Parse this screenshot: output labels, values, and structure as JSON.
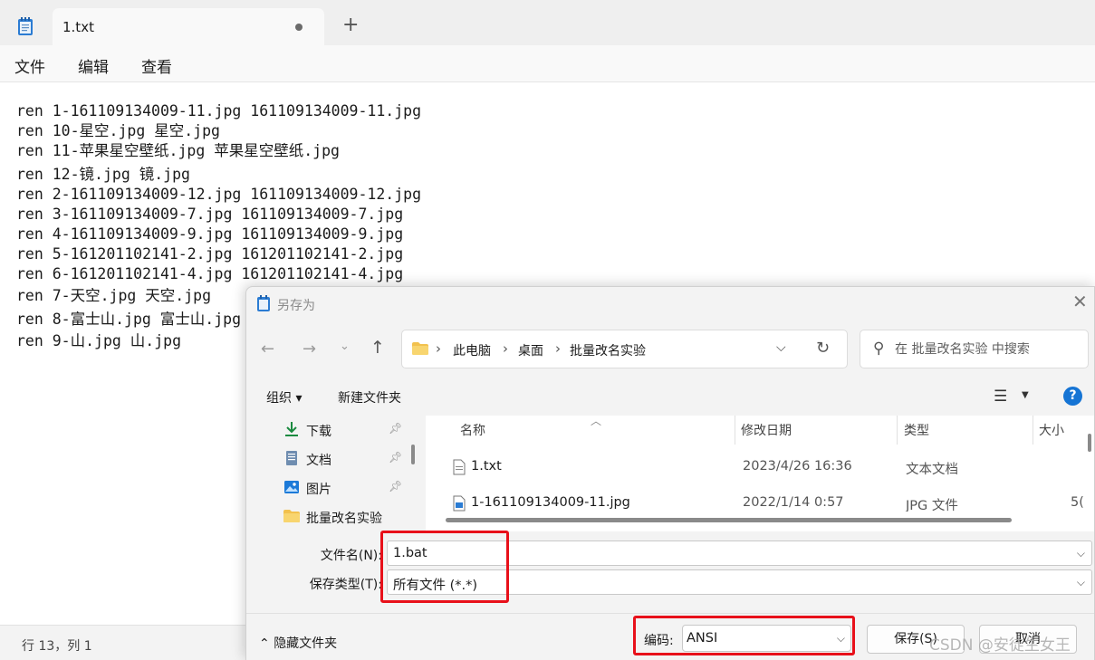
{
  "notepad": {
    "tab_title": "1.txt",
    "new_tab": "+",
    "menu": [
      "文件",
      "编辑",
      "查看"
    ],
    "lines": [
      "ren 1-161109134009-11.jpg 161109134009-11.jpg",
      "ren 10-星空.jpg 星空.jpg",
      "ren 11-苹果星空壁纸.jpg 苹果星空壁纸.jpg",
      "ren 12-镜.jpg 镜.jpg",
      "ren 2-161109134009-12.jpg 161109134009-12.jpg",
      "ren 3-161109134009-7.jpg 161109134009-7.jpg",
      "ren 4-161109134009-9.jpg 161109134009-9.jpg",
      "ren 5-161201102141-2.jpg 161201102141-2.jpg",
      "ren 6-161201102141-4.jpg 161201102141-4.jpg",
      "ren 7-天空.jpg 天空.jpg",
      "ren 8-富士山.jpg 富士山.jpg",
      "ren 9-山.jpg 山.jpg"
    ],
    "status": "行 13，列 1"
  },
  "dialog": {
    "title": "另存为",
    "close": "✕",
    "breadcrumb": [
      "此电脑",
      "桌面",
      "批量改名实验"
    ],
    "search_placeholder": "在 批量改名实验 中搜索",
    "toolbar": {
      "organize": "组织 ▾",
      "new_folder": "新建文件夹"
    },
    "help": "?",
    "nav_items": [
      {
        "label": "下载",
        "icon": "download-icon",
        "pinned": true
      },
      {
        "label": "文档",
        "icon": "document-icon",
        "pinned": true
      },
      {
        "label": "图片",
        "icon": "picture-icon",
        "pinned": true
      },
      {
        "label": "批量改名实验",
        "icon": "folder-icon",
        "pinned": false
      }
    ],
    "columns": [
      "名称",
      "修改日期",
      "类型",
      "大小"
    ],
    "files": [
      {
        "name": "1.txt",
        "date": "2023/4/26 16:36",
        "type": "文本文档",
        "size": "",
        "icon": "text-file-icon"
      },
      {
        "name": "1-161109134009-11.jpg",
        "date": "2022/1/14 0:57",
        "type": "JPG 文件",
        "size": "5(",
        "icon": "image-file-icon"
      }
    ],
    "filename_label": "文件名(N):",
    "filename_value": "1.bat",
    "filetype_label": "保存类型(T):",
    "filetype_value": "所有文件  (*.*)",
    "hide_folders": "隐藏文件夹",
    "encoding_label": "编码:",
    "encoding_value": "ANSI",
    "save_button": "保存(S)",
    "cancel_button": "取消"
  },
  "watermark": "CSDN @安徒生女王",
  "colors": {
    "highlight": "#e8101a",
    "accent": "#1574d4"
  }
}
